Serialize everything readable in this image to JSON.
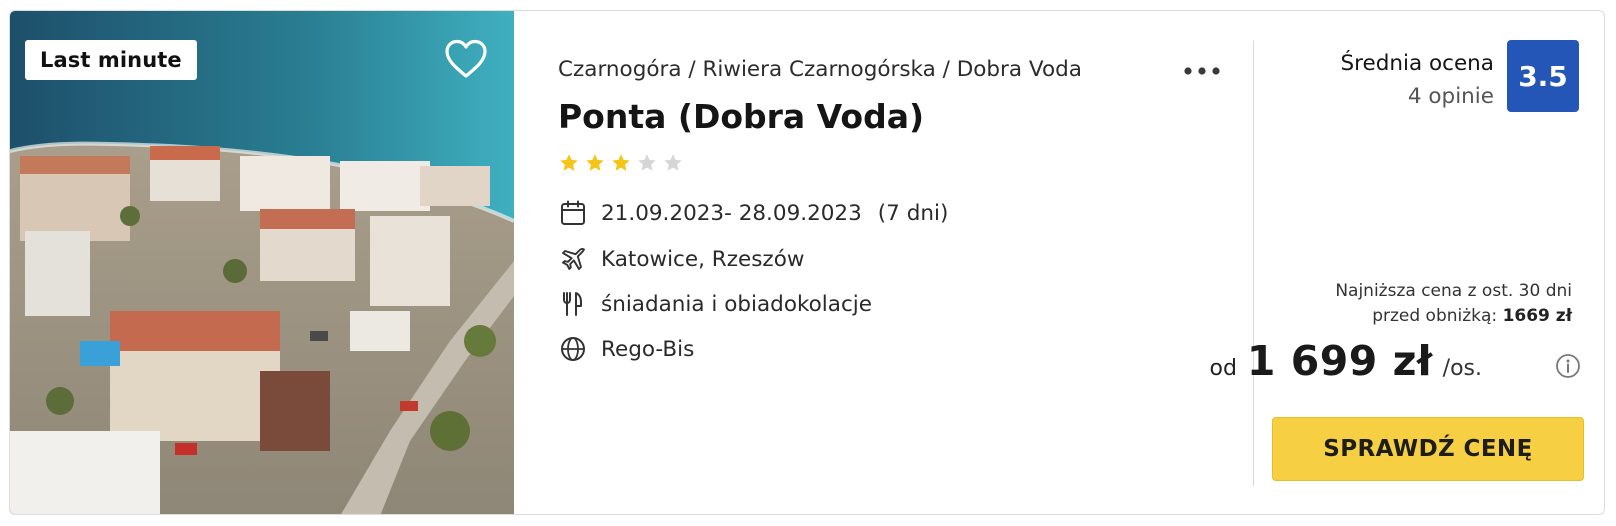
{
  "photo": {
    "badge": "Last minute",
    "alt_icon": "heart-icon"
  },
  "hotel": {
    "breadcrumb": "Czarnogóra / Riwiera Czarnogórska / Dobra Voda",
    "name": "Ponta (Dobra Voda)",
    "stars_filled": 3,
    "stars_total": 5
  },
  "details": {
    "dates": "21.09.2023- 28.09.2023",
    "duration": "(7 dni)",
    "departure": "Katowice, Rzeszów",
    "board": "śniadania i obiadokolacje",
    "operator": "Rego-Bis"
  },
  "icons": {
    "dates": "calendar-icon",
    "departure": "plane-icon",
    "board": "cutlery-icon",
    "operator": "globe-icon"
  },
  "rating": {
    "label": "Średnia ocena",
    "count": "4 opinie",
    "score": "3.5"
  },
  "price": {
    "lowest_line1": "Najniższa cena z ost. 30 dni",
    "lowest_line2_prefix": "przed obniżką:",
    "lowest_value": "1669 zł",
    "from": "od",
    "value": "1 699 zł",
    "per": "/os."
  },
  "cta": {
    "label": "SPRAWDŹ CENĘ"
  },
  "colors": {
    "score_bg": "#2456b8",
    "cta_bg": "#f7cf42",
    "star_filled": "#f5c518",
    "star_empty": "#d6d6d6"
  }
}
